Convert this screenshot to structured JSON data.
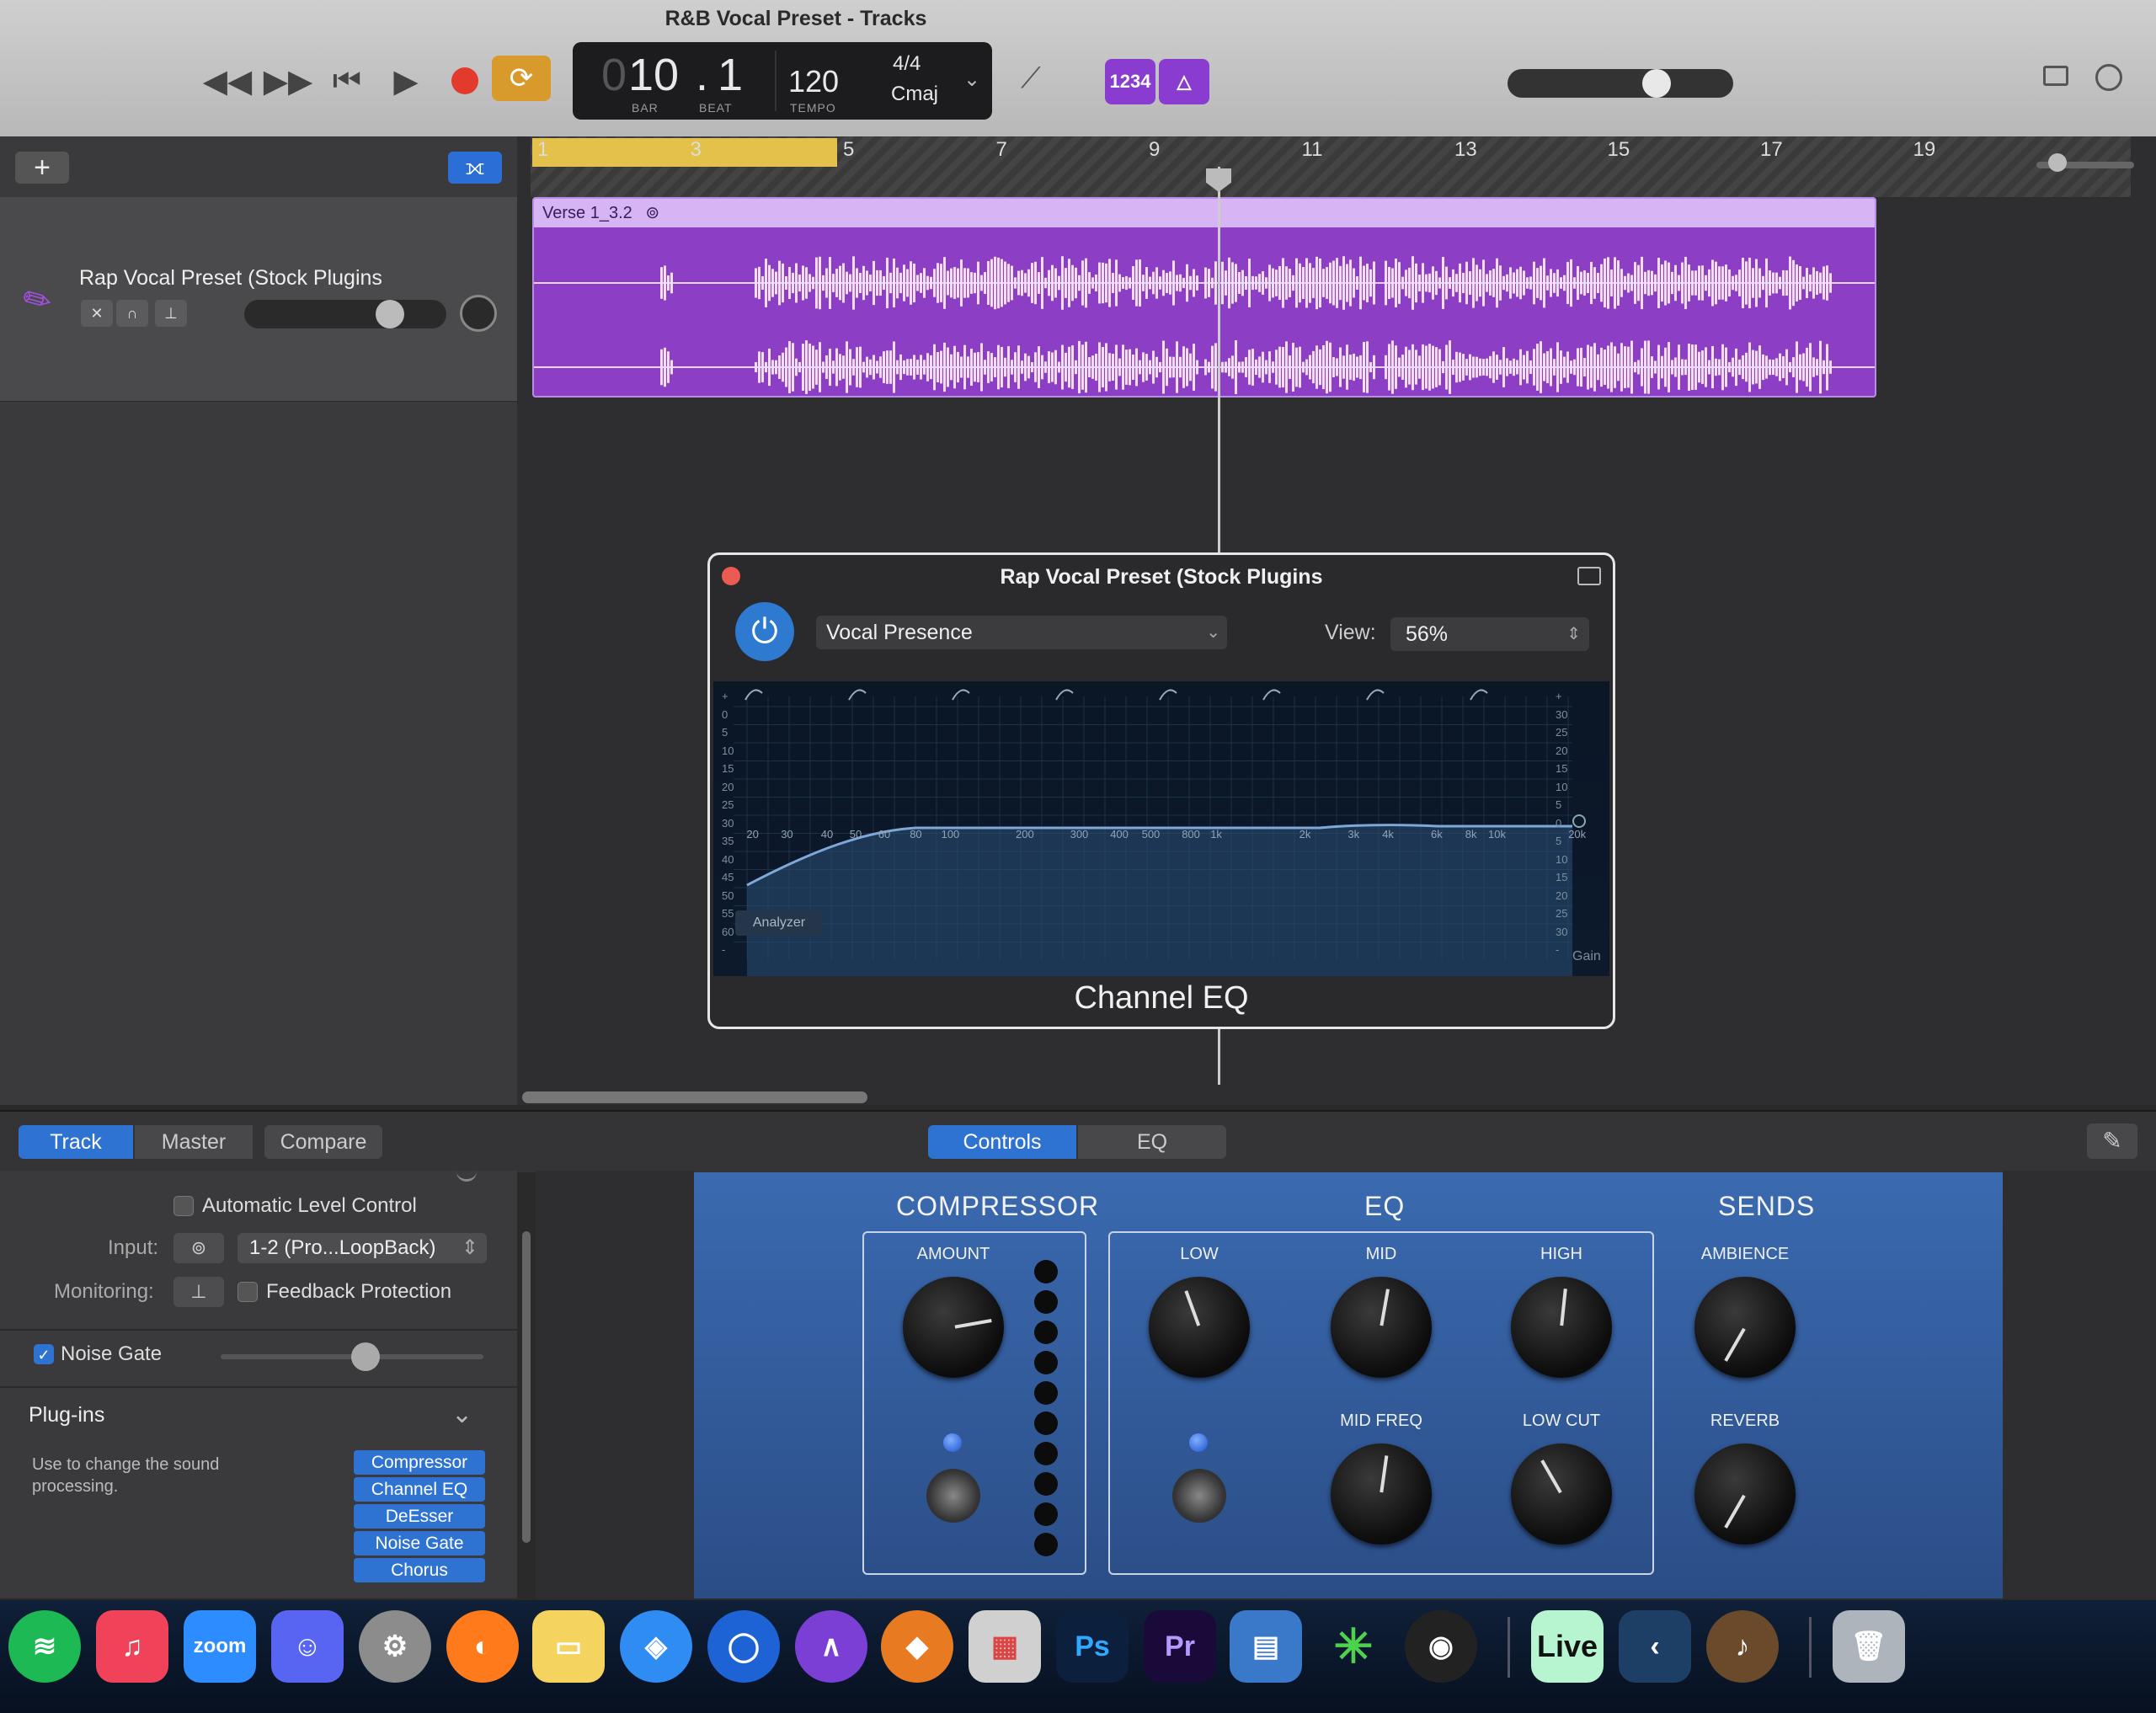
{
  "window": {
    "title": "R&B Vocal Preset - Tracks"
  },
  "transport": {
    "rewind": "◀◀",
    "forward": "▶▶",
    "to_start": "⏮",
    "play": "▶",
    "bar": "10",
    "beat": "1",
    "bar_ghost": "0",
    "bar_label": "BAR",
    "beat_label": "BEAT",
    "tempo": "120",
    "tempo_label": "TEMPO",
    "time_sig": "4/4",
    "key": "Cmaj",
    "count_in": "1234"
  },
  "tracks_header": {
    "add": "+"
  },
  "track": {
    "name": "Rap Vocal Preset (Stock Plugins"
  },
  "ruler": {
    "bars": [
      "1",
      "3",
      "5",
      "7",
      "9",
      "11",
      "13",
      "15",
      "17",
      "19"
    ]
  },
  "region": {
    "name": "Verse 1_3.2"
  },
  "plugin": {
    "title": "Rap Vocal Preset (Stock Plugins",
    "preset": "Vocal Presence",
    "view_label": "View:",
    "view_value": "56%",
    "eq_name": "Channel EQ",
    "analyzer": "Analyzer",
    "gain_label": "Gain",
    "freq_labels": [
      "20",
      "30",
      "40",
      "50",
      "60",
      "80",
      "100",
      "200",
      "300",
      "400",
      "500",
      "800",
      "1k",
      "2k",
      "3k",
      "4k",
      "6k",
      "8k",
      "10k",
      "20k"
    ],
    "left_scale": [
      "+",
      "0",
      "5",
      "10",
      "15",
      "20",
      "25",
      "30",
      "35",
      "40",
      "45",
      "50",
      "55",
      "60",
      "-"
    ],
    "right_scale": [
      "+",
      "30",
      "25",
      "20",
      "15",
      "10",
      "5",
      "0",
      "5",
      "10",
      "15",
      "20",
      "25",
      "30",
      "-"
    ]
  },
  "smart_controls": {
    "tabs": [
      "Track",
      "Master",
      "Compare"
    ],
    "view_tabs": [
      "Controls",
      "EQ"
    ],
    "automatic_level_control": "Automatic Level Control",
    "input_label": "Input:",
    "input_value": "1-2  (Pro...LoopBack)",
    "monitoring_label": "Monitoring:",
    "feedback_protection": "Feedback Protection",
    "noise_gate": "Noise Gate",
    "noise_gate_level": 0.55,
    "plugins_title": "Plug-ins",
    "plugins_help": "Use to change the sound processing.",
    "plugins": [
      "Compressor",
      "Channel EQ",
      "DeEsser",
      "Noise Gate",
      "Chorus"
    ],
    "compressor": {
      "title": "COMPRESSOR",
      "amount": "AMOUNT"
    },
    "eq": {
      "title": "EQ",
      "low": "LOW",
      "mid": "MID",
      "high": "HIGH",
      "mid_freq": "MID FREQ",
      "low_cut": "LOW CUT"
    },
    "sends": {
      "title": "SENDS",
      "ambience": "AMBIENCE",
      "reverb": "REVERB"
    }
  },
  "dock": {
    "zoom": "zoom",
    "photoshop": "Ps",
    "premiere": "Pr",
    "live": "Live"
  }
}
